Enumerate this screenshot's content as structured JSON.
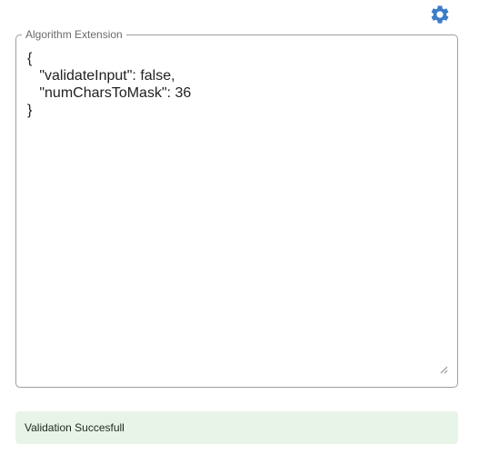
{
  "header": {
    "settings_icon": "gear-icon",
    "accent_color": "#3d7cc9"
  },
  "editor": {
    "label": "Algorithm Extension",
    "value": "{\n   \"validateInput\": false,\n   \"numCharsToMask\": 36\n}"
  },
  "status": {
    "message": "Validation Succesfull",
    "background": "#e8f4e8"
  }
}
